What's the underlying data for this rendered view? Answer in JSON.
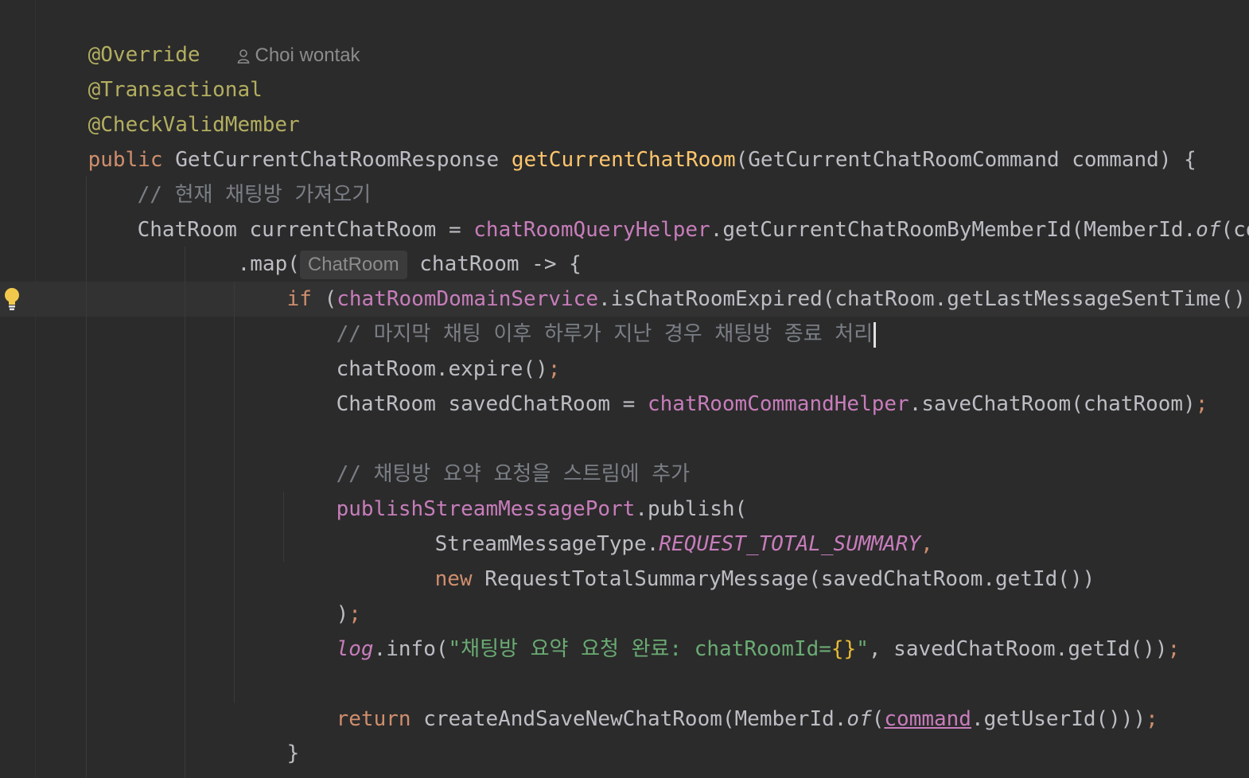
{
  "editor": {
    "author_hint": "Choi wontak",
    "type_hint": "ChatRoom",
    "lines": {
      "l1": "@Override",
      "l2": "@Transactional",
      "l3": "@CheckValidMember",
      "l4_kw": "public",
      "l4_type": " GetCurrentChatRoomResponse ",
      "l4_name": "getCurrentChatRoom",
      "l4_rest": "(GetCurrentChatRoomCommand command) {",
      "l5": "// 현재 채팅방 가져오기",
      "l6_a": "ChatRoom currentChatRoom = ",
      "l6_field": "chatRoomQueryHelper",
      "l6_b": ".getCurrentChatRoomByMemberId(MemberId.",
      "l6_of": "of",
      "l6_c": "(command",
      "l7_a": ".map(",
      "l7_b": "chatRoom -> {",
      "l8_kw": "if",
      "l8_a": " (",
      "l8_field": "chatRoomDomainService",
      "l8_b": ".isChatRoomExpired(chatRoom.getLastMessageSentTime())) {",
      "l9": "// 마지막 채팅 이후 하루가 지난 경우 채팅방 종료 처리",
      "l10": "chatRoom.expire()",
      "l11_a": "ChatRoom savedChatRoom = ",
      "l11_field": "chatRoomCommandHelper",
      "l11_b": ".saveChatRoom(chatRoom)",
      "l13": "// 채팅방 요약 요청을 스트림에 추가",
      "l14_field": "publishStreamMessagePort",
      "l14_b": ".publish(",
      "l15_a": "StreamMessageType.",
      "l15_const": "REQUEST_TOTAL_SUMMARY",
      "l15_b": ",",
      "l16_kw": "new",
      "l16_b": " RequestTotalSummaryMessage(savedChatRoom.getId())",
      "l17": ")",
      "l18_log": "log",
      "l18_a": ".info(",
      "l18_str1": "\"채팅방 요약 요청 완료: chatRoomId=",
      "l18_brace": "{}",
      "l18_str2": "\"",
      "l18_b": ", savedChatRoom.getId())",
      "l20_kw": "return",
      "l20_a": " createAndSaveNewChatRoom(MemberId.",
      "l20_of": "of",
      "l20_b": "(",
      "l20_param": "command",
      "l20_c": ".getUserId()))",
      "l21": "}",
      "semicolon": ";"
    }
  },
  "colors": {
    "background": "#2b2b2b",
    "keyword": "#cf8e6d",
    "annotation": "#b3ae60",
    "field": "#c77dbb",
    "comment": "#7a7e85",
    "string": "#6aab73",
    "method_declaration": "#ffc66d"
  },
  "icons": {
    "author": "person-icon",
    "intention": "lightbulb-icon"
  }
}
